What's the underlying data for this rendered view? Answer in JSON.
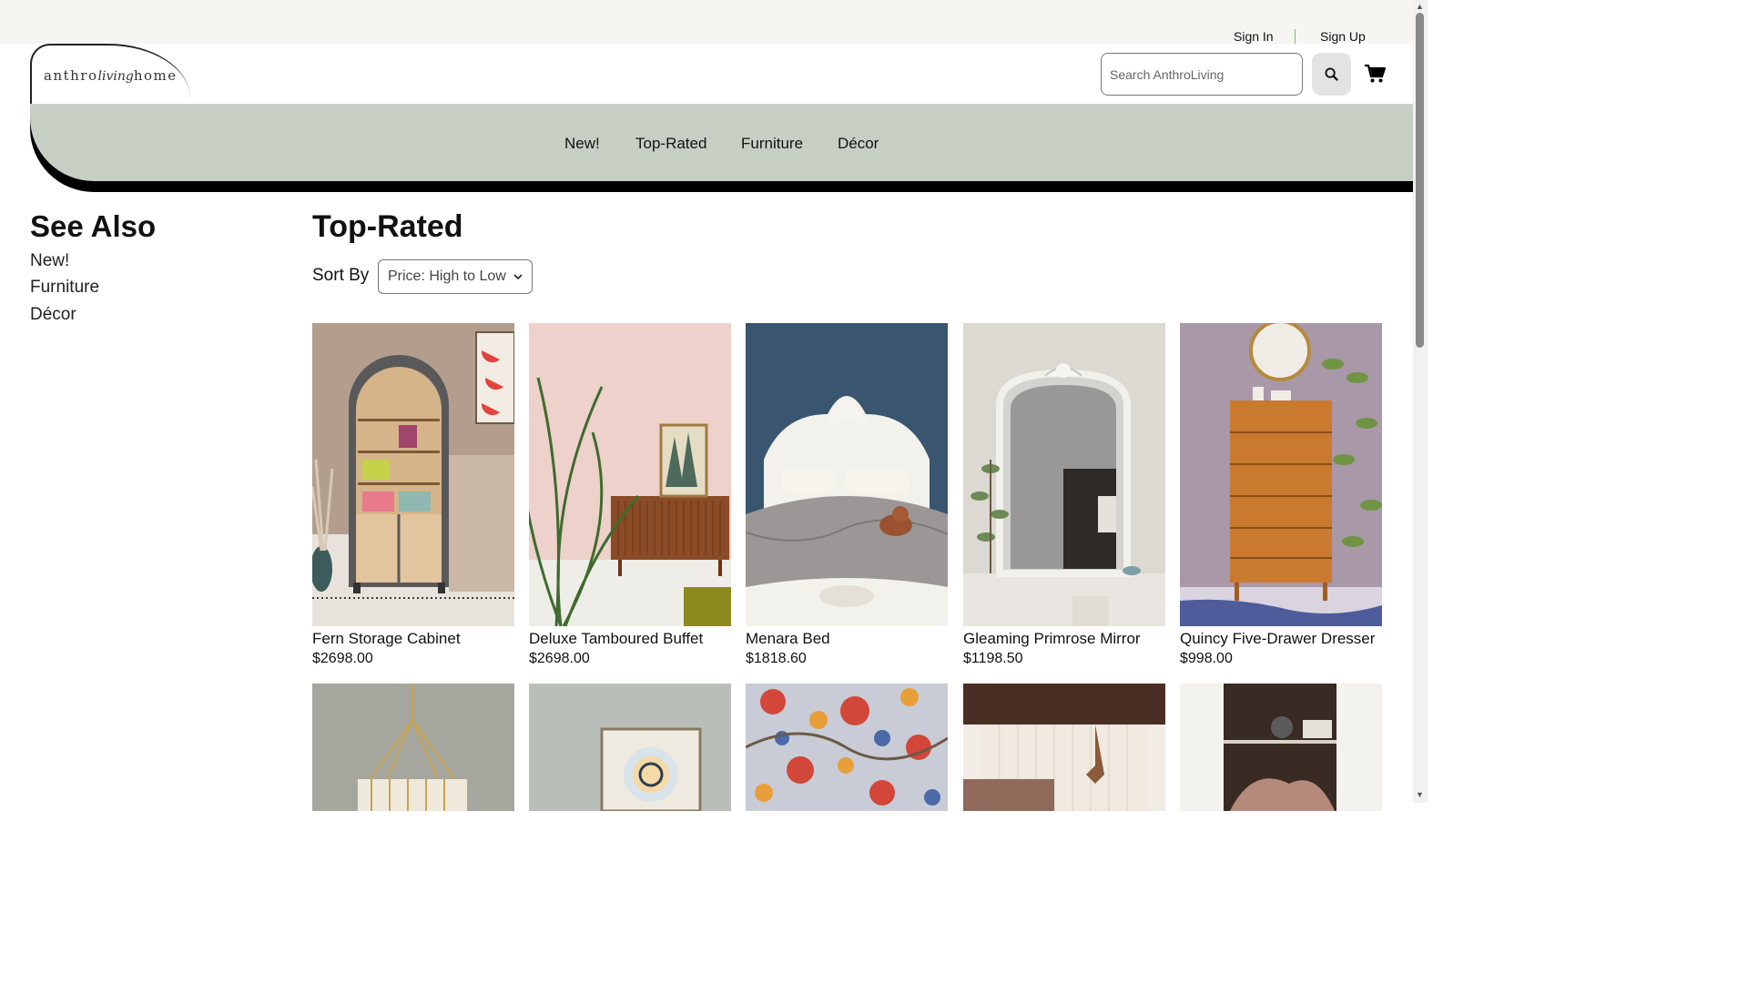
{
  "auth": {
    "sign_in": "Sign In",
    "sign_up": "Sign Up"
  },
  "logo": {
    "left": "anthro",
    "script": "living",
    "right": "home"
  },
  "search": {
    "placeholder": "Search AnthroLiving"
  },
  "nav": [
    "New!",
    "Top-Rated",
    "Furniture",
    "Décor"
  ],
  "sidebar": {
    "title": "See Also",
    "links": [
      "New!",
      "Furniture",
      "Décor"
    ]
  },
  "main": {
    "title": "Top-Rated",
    "sort_label": "Sort By",
    "sort_value": "Price: High to Low",
    "products": [
      {
        "name": "Fern Storage Cabinet",
        "price": "$2698.00"
      },
      {
        "name": "Deluxe Tamboured Buffet",
        "price": "$2698.00"
      },
      {
        "name": "Menara Bed",
        "price": "$1818.60"
      },
      {
        "name": "Gleaming Primrose Mirror",
        "price": "$1198.50"
      },
      {
        "name": "Quincy Five-Drawer Dresser",
        "price": "$998.00"
      }
    ]
  },
  "colors": {
    "nav_band": "#c7cfc5",
    "topbar": "#f6f5f2",
    "accent_separator": "#7fb77a"
  }
}
